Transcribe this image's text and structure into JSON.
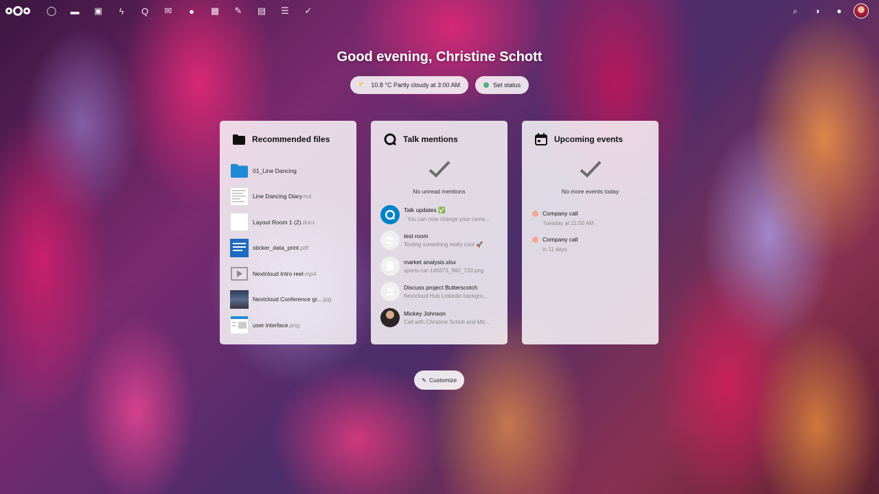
{
  "topbar": {
    "apps": [
      {
        "name": "dashboard",
        "glyph": "◯"
      },
      {
        "name": "files",
        "glyph": "▬"
      },
      {
        "name": "photos",
        "glyph": "▣"
      },
      {
        "name": "activity",
        "glyph": "ϟ"
      },
      {
        "name": "talk",
        "glyph": "Q"
      },
      {
        "name": "mail",
        "glyph": "✉"
      },
      {
        "name": "contacts",
        "glyph": "●"
      },
      {
        "name": "calendar",
        "glyph": "▦"
      },
      {
        "name": "notes",
        "glyph": "✎"
      },
      {
        "name": "deck",
        "glyph": "▤"
      },
      {
        "name": "tasks",
        "glyph": "☰"
      },
      {
        "name": "checks",
        "glyph": "✓"
      }
    ],
    "right": [
      {
        "name": "search",
        "glyph": "⌕"
      },
      {
        "name": "notifications",
        "glyph": "◑"
      },
      {
        "name": "contacts-menu",
        "glyph": "●"
      }
    ]
  },
  "greeting": "Good evening, Christine Schott",
  "status": {
    "weather": "10.8 °C Partly cloudy at 3:00 AM",
    "set_status": "Set status",
    "status_color": "#49b382"
  },
  "recommended": {
    "title": "Recommended files",
    "files": [
      {
        "name": "01_Line Dancing",
        "ext": "",
        "type": "folder"
      },
      {
        "name": "Line Dancing Diary",
        "ext": ".md",
        "type": "doc"
      },
      {
        "name": "Layout Room 1 (2)",
        "ext": ".docx",
        "type": "blank"
      },
      {
        "name": "sticker_data_print",
        "ext": ".pdf",
        "type": "sticker"
      },
      {
        "name": "Nextcloud Intro reel",
        "ext": ".mp4",
        "type": "video"
      },
      {
        "name": "Nextcloud Conference gr...",
        "ext": ".jpg",
        "type": "photo"
      },
      {
        "name": "user interface",
        "ext": ".png",
        "type": "ui"
      }
    ]
  },
  "talk": {
    "title": "Talk mentions",
    "empty": "No unread mentions",
    "items": [
      {
        "title": "Talk updates ✅",
        "sub": "- You can now change your came...",
        "avatar": "talk"
      },
      {
        "title": "test room",
        "sub": "Testing something really cool 🚀",
        "avatar": "group"
      },
      {
        "title": "market analysis.xlsx",
        "sub": "sports-car-146873_960_720.png",
        "avatar": "file"
      },
      {
        "title": "Discuss project Butterscotch",
        "sub": "Nextcloud Hub Linkedin backgro...",
        "avatar": "group"
      },
      {
        "title": "Mickey Johnson",
        "sub": "Call with Christine Schott and Mic...",
        "avatar": "person"
      }
    ]
  },
  "events": {
    "title": "Upcoming events",
    "empty": "No more events today",
    "items": [
      {
        "title": "Company call",
        "sub": "Tuesday at 11:00 AM"
      },
      {
        "title": "Company call",
        "sub": "in 11 days"
      }
    ]
  },
  "customize": "Customize",
  "colors": {
    "accent": "#0082c9",
    "event_dot": "#f2a890"
  }
}
